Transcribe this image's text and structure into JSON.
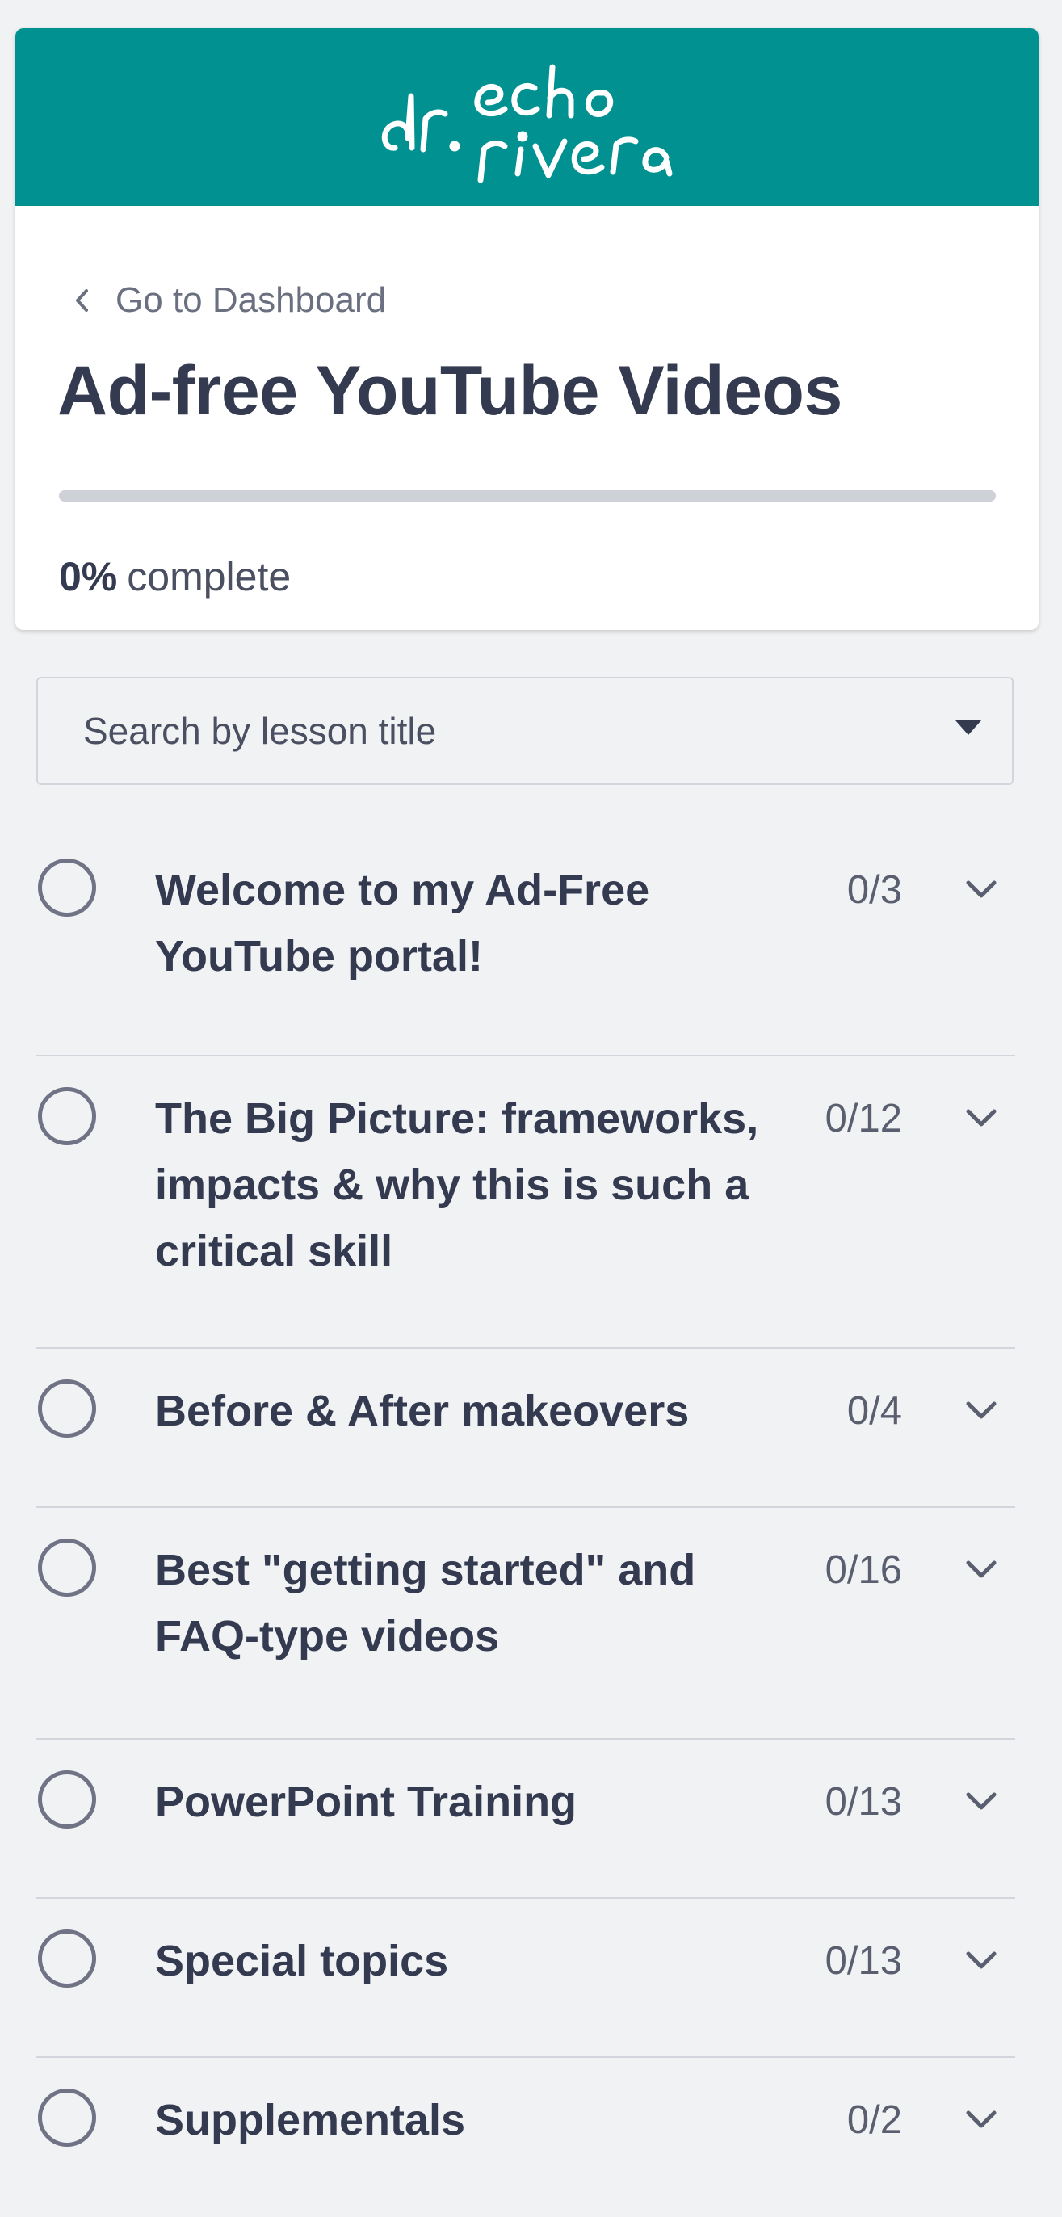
{
  "colors": {
    "brand": "#009190",
    "page_background": "#f1f2f4",
    "text_primary": "#343a4f",
    "progress_track": "#cfd1d9"
  },
  "header": {
    "logo_text_line1": "dr. echo",
    "logo_text_line2": "rivera",
    "back_link_icon": "chevron-left-icon",
    "back_link_label": "Go to Dashboard",
    "course_title": "Ad-free YouTube Videos",
    "progress_percent": 0,
    "progress_value": "0%",
    "progress_suffix": "complete"
  },
  "search": {
    "placeholder": "Search by lesson title",
    "icon": "caret-down-icon"
  },
  "sections": [
    {
      "title": "Welcome to my Ad-Free YouTube portal!",
      "count": "0/3",
      "completed": false,
      "expand_icon": "chevron-down-icon"
    },
    {
      "title": "The Big Picture: frameworks, impacts & why this is such a critical skill",
      "count": "0/12",
      "completed": false,
      "expand_icon": "chevron-down-icon"
    },
    {
      "title": "Before & After makeovers",
      "count": "0/4",
      "completed": false,
      "expand_icon": "chevron-down-icon"
    },
    {
      "title": "Best \"getting started\" and FAQ-type videos",
      "count": "0/16",
      "completed": false,
      "expand_icon": "chevron-down-icon"
    },
    {
      "title": "PowerPoint Training",
      "count": "0/13",
      "completed": false,
      "expand_icon": "chevron-down-icon"
    },
    {
      "title": "Special topics",
      "count": "0/13",
      "completed": false,
      "expand_icon": "chevron-down-icon"
    },
    {
      "title": "Supplementals",
      "count": "0/2",
      "completed": false,
      "expand_icon": "chevron-down-icon"
    }
  ]
}
